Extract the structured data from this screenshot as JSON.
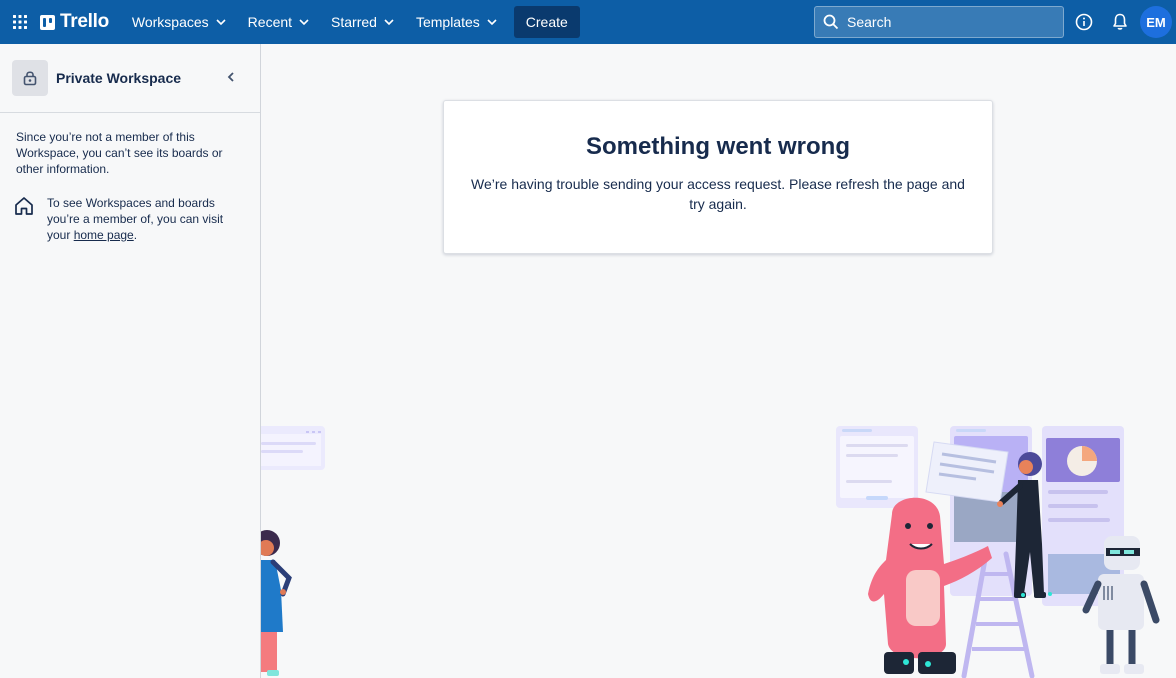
{
  "header": {
    "logo_text": "Trello",
    "nav": [
      {
        "label": "Workspaces"
      },
      {
        "label": "Recent"
      },
      {
        "label": "Starred"
      },
      {
        "label": "Templates"
      }
    ],
    "create_label": "Create",
    "search_placeholder": "Search",
    "avatar_initials": "EM",
    "colors": {
      "bar": "#0d5ea6",
      "create_button": "#0a3a6e",
      "avatar": "#1d6fde"
    }
  },
  "sidebar": {
    "workspace_name": "Private Workspace",
    "notice": "Since you’re not a member of this Workspace, you can’t see its boards or other information.",
    "home_text_before": "To see Workspaces and boards you’re a member of, you can visit your ",
    "home_link": "home page",
    "home_text_after": "."
  },
  "main": {
    "error_title": "Something went wrong",
    "error_message": "We’re having trouble sending your access request. Please refresh the page and try again."
  },
  "icons": [
    "apps-grid-icon",
    "chevron-down-icon",
    "search-icon",
    "info-icon",
    "bell-icon",
    "lock-icon",
    "chevron-left-icon",
    "home-icon"
  ]
}
